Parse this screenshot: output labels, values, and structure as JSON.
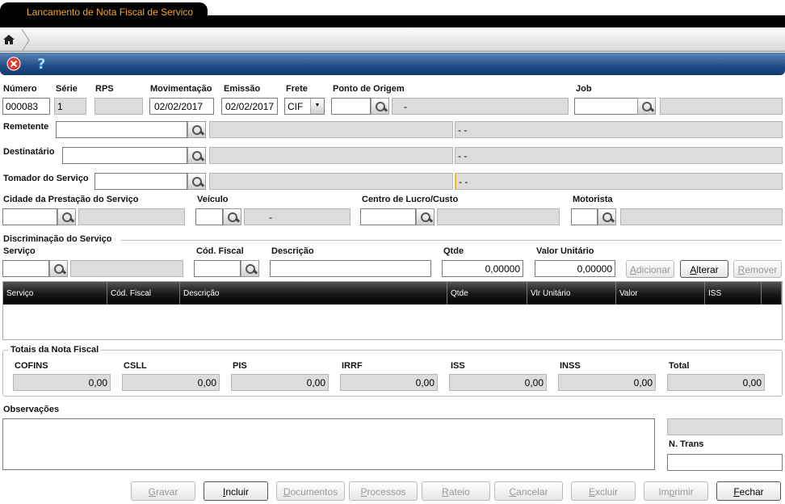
{
  "window": {
    "title": "Lançamento de Nota Fiscal de Serviço"
  },
  "toolbar": {
    "close_icon": "close-circle-icon",
    "help_icon": "help-question-icon"
  },
  "fields": {
    "numero": {
      "label": "Número",
      "value": "000083"
    },
    "serie": {
      "label": "Série",
      "value": "1"
    },
    "rps": {
      "label": "RPS",
      "value": ""
    },
    "movimentacao": {
      "label": "Movimentação",
      "value": "02/02/2017"
    },
    "emissao": {
      "label": "Emissão",
      "value": "02/02/2017"
    },
    "frete": {
      "label": "Frete",
      "value": "CIF"
    },
    "ponto_origem": {
      "label": "Ponto de Origem",
      "value": "",
      "desc": "-"
    },
    "job": {
      "label": "Job",
      "value": ""
    },
    "remetente": {
      "label": "Remetente",
      "desc2": "- -"
    },
    "destinatario": {
      "label": "Destinatário",
      "desc2": "- -"
    },
    "tomador": {
      "label": "Tomador do Serviço",
      "desc2": "- -"
    },
    "cidade": {
      "label": "Cidade da Prestação do Serviço"
    },
    "veiculo": {
      "label": "Veículo",
      "desc": "-"
    },
    "centro": {
      "label": "Centro de Lucro/Custo"
    },
    "motorista": {
      "label": "Motorista"
    }
  },
  "servico_section": {
    "title": "Discriminação do Serviço",
    "servico": "Serviço",
    "cod_fiscal": "Cód. Fiscal",
    "descricao": "Descrição",
    "qtde": "Qtde",
    "qtde_value": "0,00000",
    "valor_unitario": "Valor Unitário",
    "valor_unitario_value": "0,00000",
    "adicionar": "Adicionar",
    "alterar": "Alterar",
    "remover": "Remover"
  },
  "grid": {
    "columns": [
      "Serviço",
      "Cód. Fiscal",
      "Descrição",
      "Qtde",
      "Vlr Unitário",
      "Valor",
      "ISS"
    ]
  },
  "totais": {
    "title": "Totais da Nota Fiscal",
    "items": [
      {
        "label": "COFINS",
        "value": "0,00"
      },
      {
        "label": "CSLL",
        "value": "0,00"
      },
      {
        "label": "PIS",
        "value": "0,00"
      },
      {
        "label": "IRRF",
        "value": "0,00"
      },
      {
        "label": "ISS",
        "value": "0,00"
      },
      {
        "label": "INSS",
        "value": "0,00"
      },
      {
        "label": "Total",
        "value": "0,00"
      }
    ]
  },
  "observacoes": {
    "label": "Observações",
    "value": ""
  },
  "ntrans": {
    "label": "N. Trans",
    "value": ""
  },
  "buttons": [
    "Gravar",
    "Incluir",
    "Documentos",
    "Processos",
    "Rateio",
    "Cancelar",
    "Excluir",
    "Imprimir",
    "Fechar"
  ]
}
